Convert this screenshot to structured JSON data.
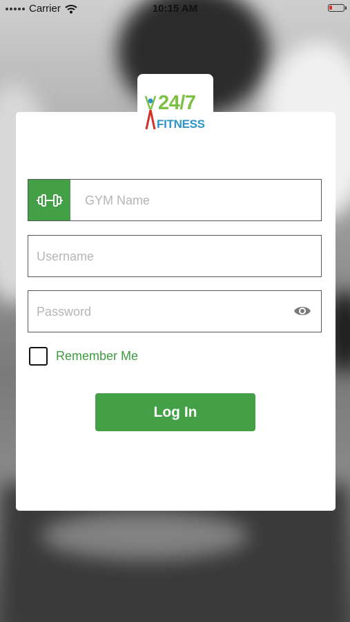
{
  "status_bar": {
    "carrier": "Carrier",
    "time": "10:15 AM"
  },
  "logo": {
    "title": "24/7",
    "subtitle": "FITNESS"
  },
  "form": {
    "gym_placeholder": "GYM Name",
    "username_placeholder": "Username",
    "password_placeholder": "Password",
    "remember_label": "Remember Me",
    "remember_checked": false,
    "login_label": "Log In"
  },
  "colors": {
    "accent": "#43a047",
    "remember_text": "#3d9c3f",
    "logo_green": "#7cc043",
    "logo_blue": "#2a93c9",
    "battery_low": "#e0302a"
  },
  "icons": [
    "wifi-icon",
    "battery-icon",
    "dumbbell-icon",
    "eye-icon",
    "figure-icon"
  ]
}
